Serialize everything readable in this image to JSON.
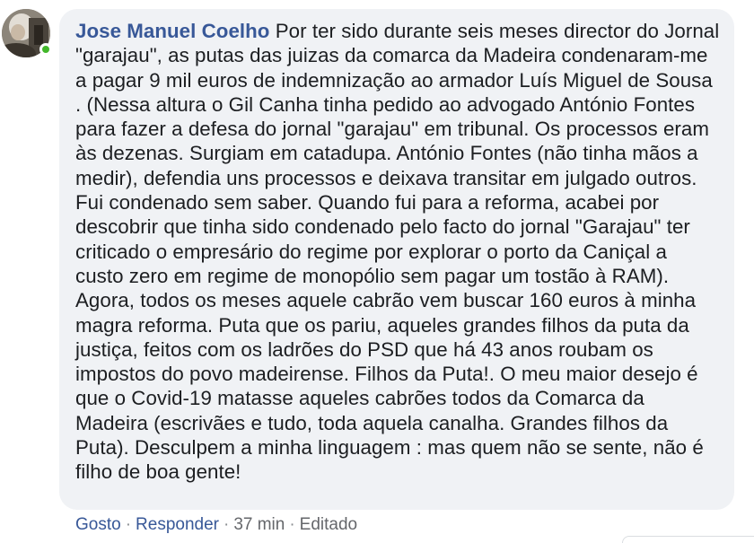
{
  "comment": {
    "author": "Jose Manuel Coelho",
    "text": "Por ter sido durante seis meses director do Jornal \"garajau\", as putas das juizas da comarca da Madeira condenaram-me a pagar 9 mil euros de indemnização ao armador Luís Miguel de Sousa . (Nessa altura o Gil Canha tinha pedido ao advogado António Fontes para fazer a defesa do jornal \"garajau\" em tribunal. Os processos eram às dezenas. Surgiam em catadupa. António Fontes (não tinha mãos a medir), defendia uns processos e deixava transitar em julgado outros. Fui condenado sem saber. Quando fui para a reforma, acabei por descobrir que tinha sido condenado pelo facto do jornal \"Garajau\" ter criticado o empresário do regime por explorar o porto da Caniçal a custo zero em regime de monopólio sem pagar um tostão à RAM). Agora, todos os meses aquele cabrão vem buscar 160 euros à minha magra reforma. Puta que os pariu, aqueles grandes filhos da puta da justiça, feitos com os ladrões do PSD que há 43 anos roubam os impostos do povo madeirense. Filhos da Puta!. O meu maior desejo é que o Covid-19 matasse aqueles cabrões todos da Comarca da Madeira (escrivães e tudo, toda aquela canalha. Grandes filhos da Puta). Desculpem a minha linguagem : mas quem não se sente, não é filho de boa gente!",
    "online_color": "#42b72a"
  },
  "actions": {
    "like": "Gosto",
    "reply": "Responder",
    "time": "37 min",
    "edited": "Editado",
    "separator": "·"
  },
  "icons": {
    "avatar": "user-photo",
    "online": "online-status-dot"
  }
}
